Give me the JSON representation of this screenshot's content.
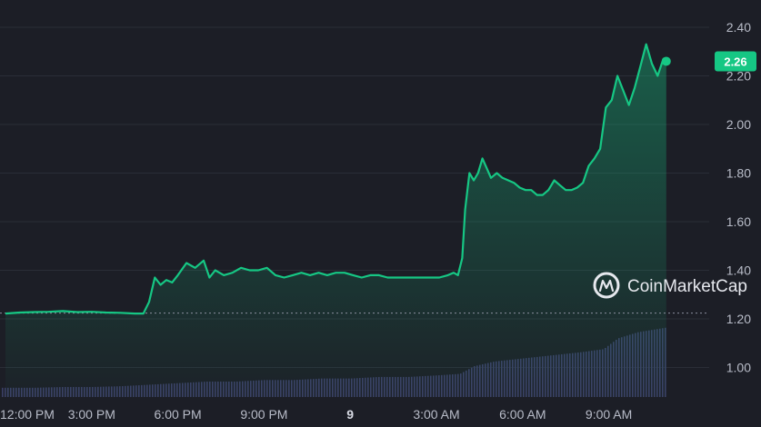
{
  "chart_data": {
    "type": "area",
    "y_ticks": [
      "2.40",
      "2.20",
      "2.00",
      "1.80",
      "1.60",
      "1.40",
      "1.20",
      "1.00"
    ],
    "ylim": [
      1.0,
      2.4
    ],
    "x_ticks": [
      {
        "label": "12:00 PM",
        "hour": 12
      },
      {
        "label": "3:00 PM",
        "hour": 15
      },
      {
        "label": "6:00 PM",
        "hour": 18
      },
      {
        "label": "9:00 PM",
        "hour": 21
      },
      {
        "label": "9",
        "hour": 24,
        "bold": true
      },
      {
        "label": "3:00 AM",
        "hour": 27
      },
      {
        "label": "6:00 AM",
        "hour": 30
      },
      {
        "label": "9:00 AM",
        "hour": 33
      }
    ],
    "current_price": "2.26",
    "reference_price": 1.224,
    "series": [
      {
        "values": [
          [
            12.0,
            1.222
          ],
          [
            12.5,
            1.226
          ],
          [
            13.0,
            1.228
          ],
          [
            13.5,
            1.229
          ],
          [
            14.0,
            1.232
          ],
          [
            14.5,
            1.228
          ],
          [
            15.0,
            1.229
          ],
          [
            15.5,
            1.226
          ],
          [
            16.0,
            1.225
          ],
          [
            16.5,
            1.222
          ],
          [
            16.8,
            1.222
          ],
          [
            17.0,
            1.27
          ],
          [
            17.2,
            1.37
          ],
          [
            17.4,
            1.34
          ],
          [
            17.6,
            1.36
          ],
          [
            17.8,
            1.35
          ],
          [
            18.0,
            1.38
          ],
          [
            18.3,
            1.43
          ],
          [
            18.6,
            1.41
          ],
          [
            18.9,
            1.44
          ],
          [
            19.1,
            1.37
          ],
          [
            19.3,
            1.4
          ],
          [
            19.6,
            1.38
          ],
          [
            19.9,
            1.39
          ],
          [
            20.2,
            1.41
          ],
          [
            20.5,
            1.4
          ],
          [
            20.8,
            1.4
          ],
          [
            21.1,
            1.41
          ],
          [
            21.4,
            1.38
          ],
          [
            21.7,
            1.37
          ],
          [
            22.0,
            1.38
          ],
          [
            22.3,
            1.39
          ],
          [
            22.6,
            1.38
          ],
          [
            22.9,
            1.39
          ],
          [
            23.2,
            1.38
          ],
          [
            23.5,
            1.39
          ],
          [
            23.8,
            1.39
          ],
          [
            24.1,
            1.38
          ],
          [
            24.4,
            1.37
          ],
          [
            24.7,
            1.38
          ],
          [
            25.0,
            1.38
          ],
          [
            25.3,
            1.37
          ],
          [
            25.6,
            1.37
          ],
          [
            25.9,
            1.37
          ],
          [
            26.2,
            1.37
          ],
          [
            26.5,
            1.37
          ],
          [
            26.8,
            1.37
          ],
          [
            27.1,
            1.37
          ],
          [
            27.4,
            1.38
          ],
          [
            27.6,
            1.39
          ],
          [
            27.75,
            1.38
          ],
          [
            27.9,
            1.45
          ],
          [
            28.0,
            1.65
          ],
          [
            28.15,
            1.8
          ],
          [
            28.3,
            1.77
          ],
          [
            28.45,
            1.8
          ],
          [
            28.6,
            1.86
          ],
          [
            28.75,
            1.82
          ],
          [
            28.9,
            1.78
          ],
          [
            29.1,
            1.8
          ],
          [
            29.3,
            1.78
          ],
          [
            29.5,
            1.77
          ],
          [
            29.7,
            1.76
          ],
          [
            29.9,
            1.74
          ],
          [
            30.1,
            1.73
          ],
          [
            30.3,
            1.73
          ],
          [
            30.5,
            1.71
          ],
          [
            30.7,
            1.71
          ],
          [
            30.9,
            1.73
          ],
          [
            31.1,
            1.77
          ],
          [
            31.3,
            1.75
          ],
          [
            31.5,
            1.73
          ],
          [
            31.7,
            1.73
          ],
          [
            31.9,
            1.74
          ],
          [
            32.1,
            1.76
          ],
          [
            32.3,
            1.83
          ],
          [
            32.5,
            1.86
          ],
          [
            32.7,
            1.9
          ],
          [
            32.9,
            2.07
          ],
          [
            33.1,
            2.1
          ],
          [
            33.3,
            2.2
          ],
          [
            33.5,
            2.14
          ],
          [
            33.7,
            2.08
          ],
          [
            33.9,
            2.15
          ],
          [
            34.1,
            2.24
          ],
          [
            34.3,
            2.33
          ],
          [
            34.5,
            2.25
          ],
          [
            34.7,
            2.2
          ],
          [
            34.9,
            2.27
          ],
          [
            35.0,
            2.26
          ]
        ]
      }
    ],
    "volume": [
      [
        12.0,
        0.06
      ],
      [
        13.0,
        0.06
      ],
      [
        14.0,
        0.065
      ],
      [
        15.0,
        0.065
      ],
      [
        16.0,
        0.07
      ],
      [
        17.0,
        0.08
      ],
      [
        18.0,
        0.09
      ],
      [
        19.0,
        0.1
      ],
      [
        20.0,
        0.1
      ],
      [
        21.0,
        0.11
      ],
      [
        22.0,
        0.11
      ],
      [
        23.0,
        0.12
      ],
      [
        24.0,
        0.12
      ],
      [
        25.0,
        0.13
      ],
      [
        26.0,
        0.13
      ],
      [
        27.0,
        0.14
      ],
      [
        27.8,
        0.15
      ],
      [
        28.3,
        0.2
      ],
      [
        29.0,
        0.23
      ],
      [
        30.0,
        0.25
      ],
      [
        31.0,
        0.27
      ],
      [
        32.0,
        0.29
      ],
      [
        32.8,
        0.31
      ],
      [
        33.3,
        0.38
      ],
      [
        34.0,
        0.42
      ],
      [
        35.0,
        0.45
      ]
    ],
    "watermark": "CoinMarketCap"
  },
  "colors": {
    "background": "#1c1e26",
    "line": "#16c784",
    "grid": "#2a2d37",
    "volume": "#3b3f66",
    "reference": "#8a8f9e"
  }
}
